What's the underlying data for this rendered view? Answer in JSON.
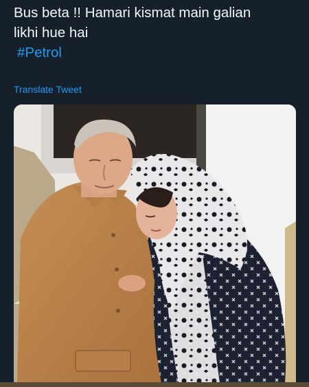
{
  "tweet": {
    "text_line_1": "Bus beta !! Hamari kismat main galian",
    "text_line_2": "likhi hue hai",
    "hashtag": "#Petrol",
    "translate_label": "Translate Tweet"
  },
  "media": {
    "kind": "photo",
    "subject": "elderly man in tan jacket embracing woman in black-and-white patterned shawl"
  },
  "colors": {
    "background": "#15202b",
    "text": "#f5f8fa",
    "link": "#1d9bf0"
  }
}
